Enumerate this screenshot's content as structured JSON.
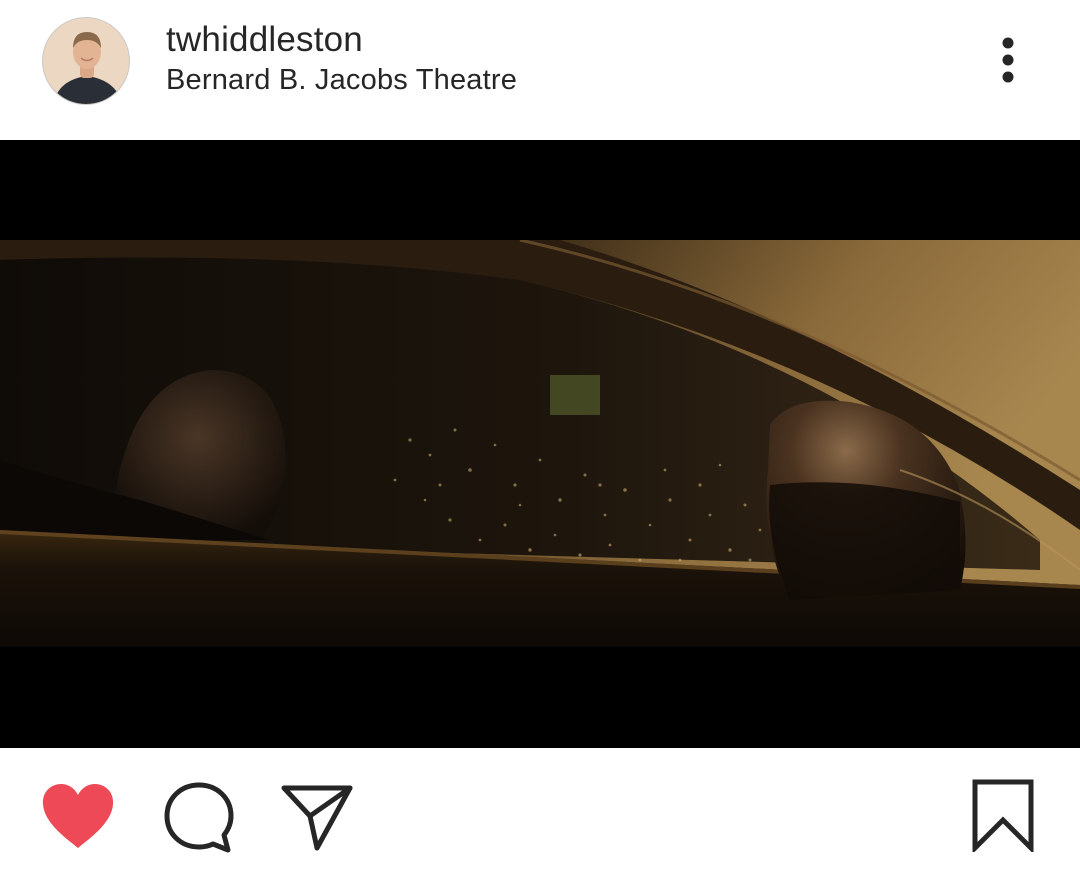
{
  "post": {
    "username": "twhiddleston",
    "location": "Bernard B. Jacobs Theatre"
  },
  "icons": {
    "avatar": "profile-photo",
    "more": "vertical-ellipsis-icon",
    "like": "heart-icon",
    "comment": "speech-bubble-icon",
    "share": "paper-plane-icon",
    "save": "bookmark-icon"
  },
  "colors": {
    "like_active": "#ed4956",
    "text_primary": "#262626",
    "icon_stroke": "#262626",
    "letterbox": "#000000"
  },
  "state": {
    "liked": true
  }
}
